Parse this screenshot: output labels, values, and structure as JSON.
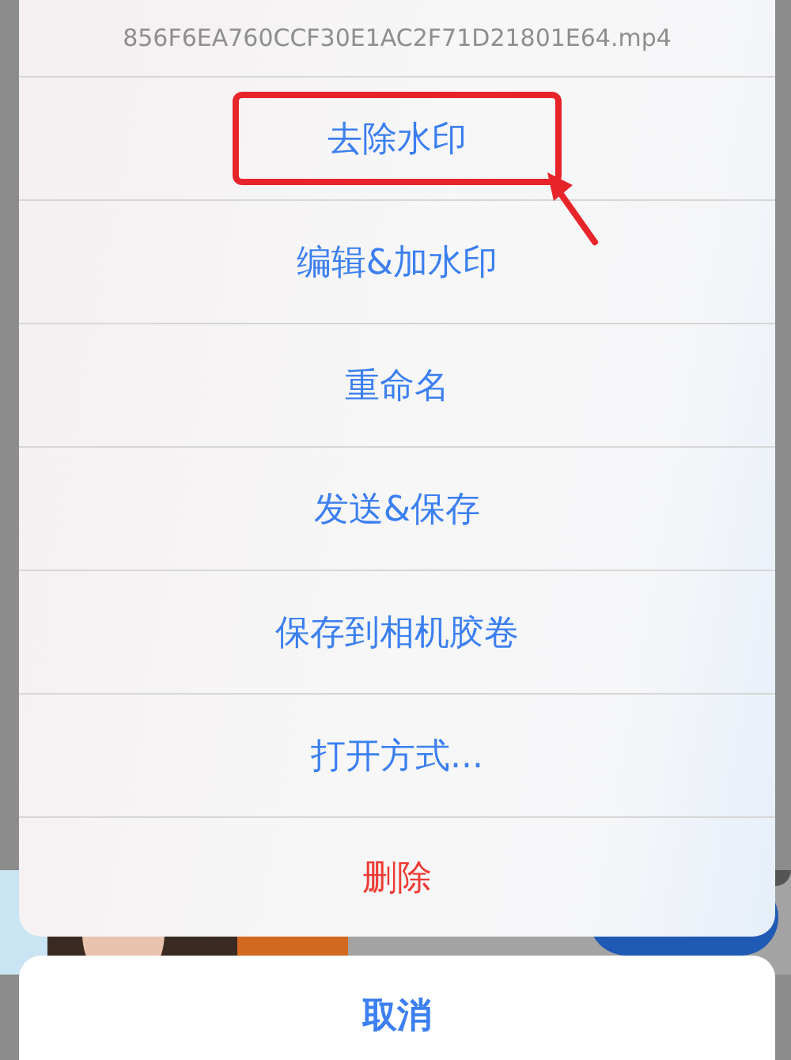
{
  "action_sheet": {
    "title": "856F6EA760CCF30E1AC2F71D21801E64.mp4",
    "items": [
      {
        "label": "去除水印",
        "kind": "action",
        "highlighted": true
      },
      {
        "label": "编辑&加水印",
        "kind": "action",
        "highlighted": false
      },
      {
        "label": "重命名",
        "kind": "action",
        "highlighted": false
      },
      {
        "label": "发送&保存",
        "kind": "action",
        "highlighted": false
      },
      {
        "label": "保存到相机胶卷",
        "kind": "action",
        "highlighted": false
      },
      {
        "label": "打开方式...",
        "kind": "action",
        "highlighted": false
      },
      {
        "label": "删除",
        "kind": "destructive",
        "highlighted": false
      }
    ]
  },
  "cancel_button": {
    "label": "取消"
  }
}
